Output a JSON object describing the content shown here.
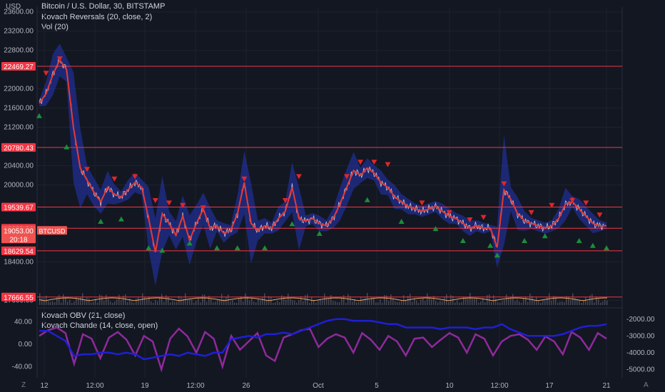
{
  "header": {
    "unit": "USD",
    "title": "Bitcoin / U.S. Dollar, 30, BITSTAMP",
    "indicator1": "Kovach Reversals (20, close, 2)",
    "indicator2": "Vol (20)",
    "sub_indicator1": "Kovach OBV (21, close)",
    "sub_indicator2": "Kovach Chande (14, close, open)"
  },
  "price_badge": {
    "price": "19053.00",
    "countdown": "20:18",
    "symbol": "BTCUSD"
  },
  "footer": {
    "left_icon": "Z",
    "right_icon": "A"
  },
  "colors": {
    "background": "#131722",
    "grid": "#1e222d",
    "text": "#d1d4dc",
    "level_line": "#f23645",
    "price_line": "#e2e2e2",
    "band": "#2436b8",
    "reversal_line": "#e53935",
    "up_marker": "#1b8f3a",
    "down_marker": "#e0262b",
    "obv_line": "#1f1fd6",
    "chande_line": "#8e2a9a",
    "volume": "#5d606b",
    "volume_ma": "#f5a25d"
  },
  "chart_data": [
    {
      "type": "line",
      "title": "Bitcoin / U.S. Dollar, 30, BITSTAMP",
      "x_ticks": [
        "12",
        "12:00",
        "19",
        "12:00",
        "26",
        "Oct",
        "5",
        "10",
        "12:00",
        "17",
        "21"
      ],
      "y_ticks": [
        "23600.00",
        "23200.00",
        "22800.00",
        "22000.00",
        "21600.00",
        "21200.00",
        "20400.00",
        "20000.00",
        "18400.00",
        "17600.00"
      ],
      "ylim": [
        17500,
        23700
      ],
      "horizontal_levels": [
        "22469.27",
        "20780.43",
        "19539.67",
        "19098.36",
        "18629.54",
        "17666.55"
      ],
      "price_series": [
        21700,
        21900,
        22300,
        22600,
        22400,
        21200,
        20350,
        20100,
        19850,
        19650,
        19950,
        19800,
        19750,
        19900,
        20050,
        19950,
        19300,
        18600,
        19400,
        19200,
        18950,
        19350,
        18850,
        19200,
        19500,
        19100,
        19150,
        19000,
        19050,
        19400,
        20050,
        19200,
        19050,
        19150,
        19100,
        19300,
        19450,
        19950,
        19300,
        19250,
        19300,
        19200,
        19150,
        19300,
        19600,
        19950,
        20300,
        20200,
        20350,
        20250,
        20050,
        19950,
        19750,
        19650,
        19550,
        19500,
        19450,
        19500,
        19550,
        19450,
        19350,
        19300,
        19200,
        19100,
        19150,
        19100,
        19100,
        18700,
        19900,
        19700,
        19400,
        19250,
        19200,
        19150,
        19100,
        19150,
        19300,
        19600,
        19650,
        19500,
        19350,
        19200,
        19150,
        19150
      ],
      "markers_down": [
        [
          1,
          22300
        ],
        [
          3,
          22600
        ],
        [
          7,
          20300
        ],
        [
          11,
          20100
        ],
        [
          14,
          20150
        ],
        [
          17,
          19650
        ],
        [
          19,
          19600
        ],
        [
          21,
          19550
        ],
        [
          24,
          19500
        ],
        [
          30,
          20100
        ],
        [
          36,
          19650
        ],
        [
          38,
          20150
        ],
        [
          45,
          20150
        ],
        [
          47,
          20450
        ],
        [
          49,
          20450
        ],
        [
          51,
          20400
        ],
        [
          56,
          19600
        ],
        [
          60,
          19400
        ],
        [
          63,
          19250
        ],
        [
          65,
          19300
        ],
        [
          68,
          20000
        ],
        [
          72,
          19400
        ],
        [
          75,
          19550
        ],
        [
          78,
          19650
        ],
        [
          80,
          19600
        ],
        [
          82,
          19350
        ]
      ],
      "markers_up": [
        [
          0,
          21450
        ],
        [
          4,
          20800
        ],
        [
          9,
          19250
        ],
        [
          12,
          19300
        ],
        [
          16,
          18700
        ],
        [
          18,
          18650
        ],
        [
          22,
          18800
        ],
        [
          26,
          18700
        ],
        [
          29,
          18700
        ],
        [
          33,
          18700
        ],
        [
          37,
          19200
        ],
        [
          41,
          19000
        ],
        [
          48,
          19700
        ],
        [
          53,
          19250
        ],
        [
          58,
          19100
        ],
        [
          62,
          18850
        ],
        [
          66,
          18750
        ],
        [
          67,
          18550
        ],
        [
          71,
          18850
        ],
        [
          74,
          18950
        ],
        [
          79,
          18850
        ],
        [
          81,
          18750
        ],
        [
          83,
          18700
        ]
      ]
    },
    {
      "type": "line",
      "y_ticks_left": [
        "40.00",
        "0.00",
        "-40.00"
      ],
      "y_ticks_right": [
        "-2000.00",
        "-3000.00",
        "-4000.00",
        "-5000.00"
      ],
      "ylim_left": [
        -60,
        60
      ],
      "ylim_right": [
        -5500,
        -1500
      ],
      "series": [
        {
          "name": "Kovach OBV (21, close)",
          "values": [
            -2700,
            -2700,
            -3000,
            -3300,
            -4200,
            -4100,
            -4100,
            -4000,
            -4000,
            -4100,
            -4000,
            -4100,
            -4400,
            -4300,
            -4200,
            -4100,
            -4200,
            -4000,
            -4100,
            -4200,
            -4000,
            -4000,
            -3200,
            -3100,
            -3000,
            -3100,
            -2900,
            -2900,
            -2800,
            -2900,
            -2700,
            -2500,
            -2300,
            -2100,
            -2000,
            -2000,
            -2100,
            -2100,
            -2100,
            -2200,
            -2300,
            -2300,
            -2500,
            -2500,
            -2500,
            -2500,
            -2600,
            -2500,
            -2500,
            -2500,
            -2600,
            -2500,
            -2500,
            -2300,
            -2600,
            -2800,
            -3000,
            -3000,
            -3000,
            -3000,
            -2900,
            -2700,
            -2500,
            -2400,
            -2400,
            -2300
          ]
        },
        {
          "name": "Kovach Chande (14, close, open)",
          "values": [
            15,
            25,
            30,
            20,
            -35,
            18,
            10,
            -25,
            12,
            22,
            8,
            -20,
            15,
            5,
            -45,
            10,
            28,
            14,
            -15,
            22,
            10,
            -40,
            15,
            -10,
            5,
            20,
            -20,
            -30,
            12,
            18,
            25,
            28,
            -5,
            10,
            18,
            12,
            -15,
            20,
            8,
            -10,
            15,
            5,
            -20,
            10,
            12,
            -5,
            8,
            20,
            12,
            -15,
            18,
            10,
            -20,
            5,
            15,
            18,
            8,
            -10,
            14,
            5,
            -18,
            22,
            12,
            -10,
            20,
            10
          ]
        }
      ]
    }
  ]
}
